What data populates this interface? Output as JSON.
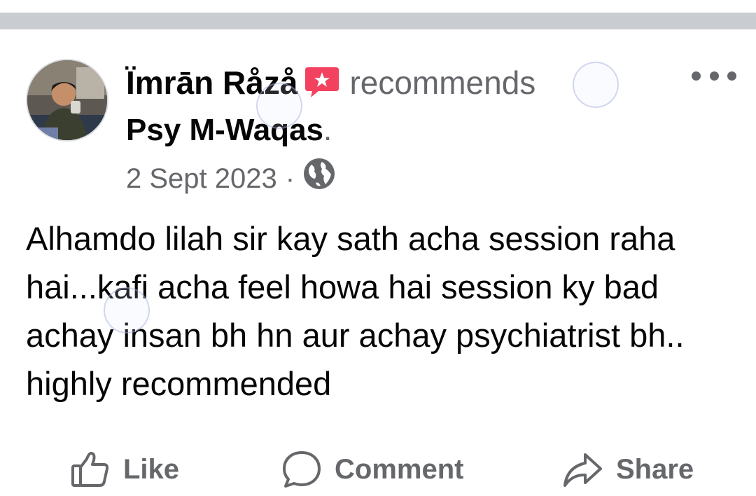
{
  "post": {
    "author": "Ïmrān Råzå",
    "verb": "recommends",
    "page_name": "Psy M-Waqas",
    "page_name_suffix": ".",
    "date": "2 Sept 2023",
    "separator": "·",
    "privacy_icon": "globe-icon",
    "text": "Alhamdo lilah sir kay sath acha session raha hai...kafi acha feel howa hai session ky bad achay insan bh hn aur achay psychiatrist bh.. highly recommended"
  },
  "actions": {
    "like": "Like",
    "comment": "Comment",
    "share": "Share"
  },
  "icons": {
    "badge": "recommend-badge-icon",
    "more": "more-options-icon",
    "like": "thumbs-up-icon",
    "comment": "comment-bubble-icon",
    "share": "share-arrow-icon"
  },
  "colors": {
    "badge": "#f3425f",
    "secondary_text": "#65676b",
    "divider": "#c9ccd1"
  }
}
